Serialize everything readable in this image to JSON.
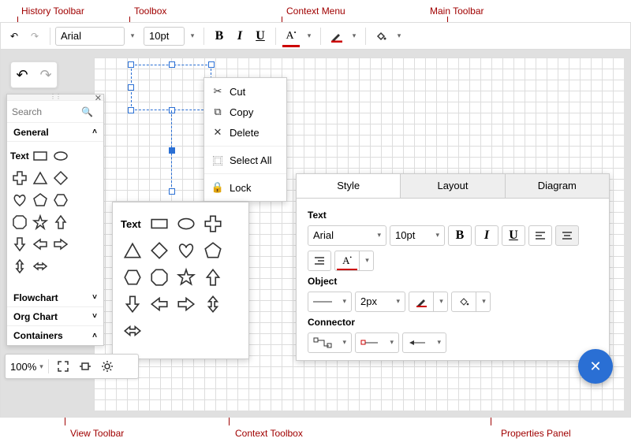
{
  "annotations": {
    "history": "History Toolbar",
    "toolbox": "Toolbox",
    "context_menu": "Context Menu",
    "main_toolbar": "Main Toolbar",
    "view_toolbar": "View Toolbar",
    "context_toolbox": "Context Toolbox",
    "properties_panel": "Properties Panel"
  },
  "main_toolbar": {
    "font_family": "Arial",
    "font_size": "10pt",
    "bold": "B",
    "italic": "I",
    "underline": "U",
    "font_color": "A"
  },
  "toolbox": {
    "search_placeholder": "Search",
    "text_label": "Text",
    "sections": {
      "general": "General",
      "flowchart": "Flowchart",
      "orgchart": "Org Chart",
      "containers": "Containers"
    }
  },
  "context_toolbox": {
    "text_label": "Text"
  },
  "context_menu": {
    "cut": "Cut",
    "copy": "Copy",
    "delete": "Delete",
    "select_all": "Select All",
    "lock": "Lock"
  },
  "properties": {
    "tabs": {
      "style": "Style",
      "layout": "Layout",
      "diagram": "Diagram"
    },
    "text_label": "Text",
    "object_label": "Object",
    "connector_label": "Connector",
    "font_family": "Arial",
    "font_size": "10pt",
    "stroke_width": "2px",
    "bold": "B",
    "italic": "I",
    "underline": "U",
    "font_color": "A"
  },
  "view_toolbar": {
    "zoom": "100%"
  },
  "fab": "✕"
}
